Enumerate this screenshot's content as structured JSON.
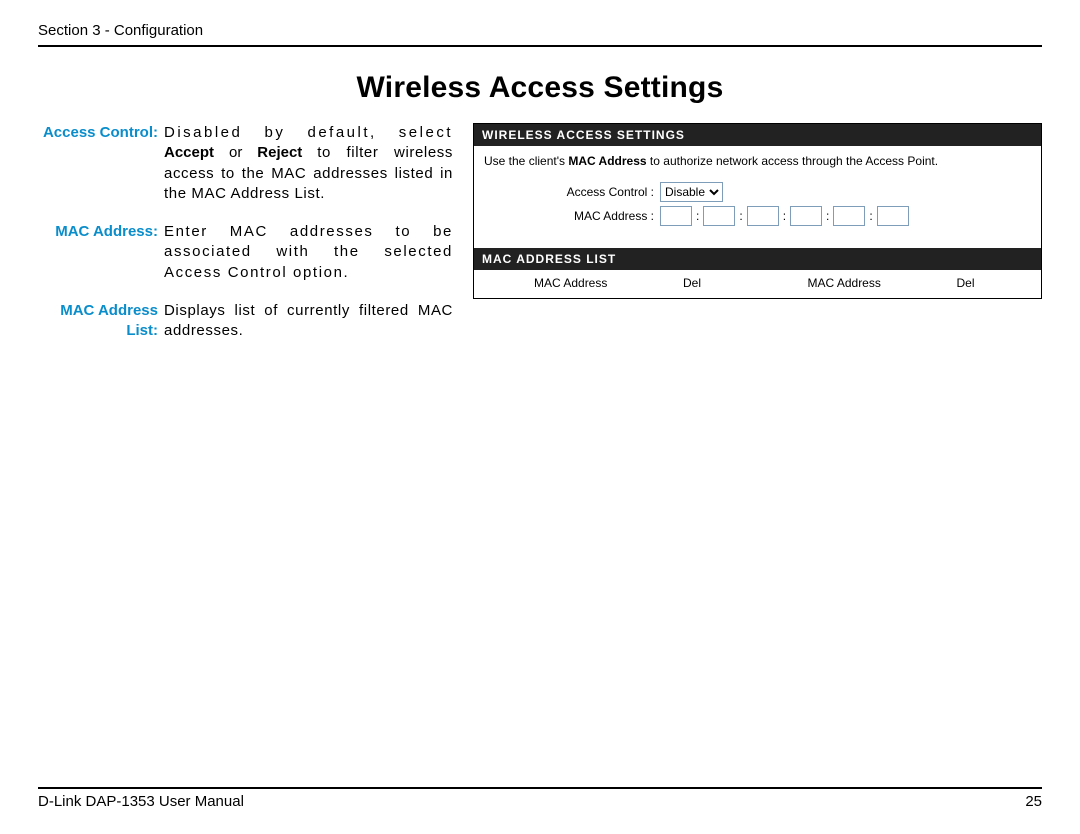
{
  "header": {
    "section": "Section 3 - Configuration"
  },
  "title": "Wireless Access Settings",
  "descriptions": {
    "access_control": {
      "label": "Access Control:",
      "pre": "Disabled by default, select",
      "bold1": "Accept",
      "mid": "or",
      "bold2": "Reject",
      "post": "to filter wireless access to the MAC addresses listed in the MAC Address List."
    },
    "mac_address": {
      "label": "MAC Address:",
      "text": "Enter MAC addresses to be associated with the selected Access Control option."
    },
    "mac_list": {
      "label_line1": "MAC Address",
      "label_line2": "List:",
      "text": "Displays list of currently filtered MAC addresses."
    }
  },
  "ui": {
    "panel1_title": "WIRELESS ACCESS SETTINGS",
    "hint_pre": "Use the client's",
    "hint_bold": "MAC Address",
    "hint_post": "to authorize network access through the Access Point.",
    "access_control_label": "Access Control :",
    "access_control_value": "Disable",
    "mac_address_label": "MAC Address :",
    "panel2_title": "MAC ADDRESS LIST",
    "col_mac": "MAC Address",
    "col_del": "Del"
  },
  "footer": {
    "left": "D-Link DAP-1353 User Manual",
    "right": "25"
  }
}
